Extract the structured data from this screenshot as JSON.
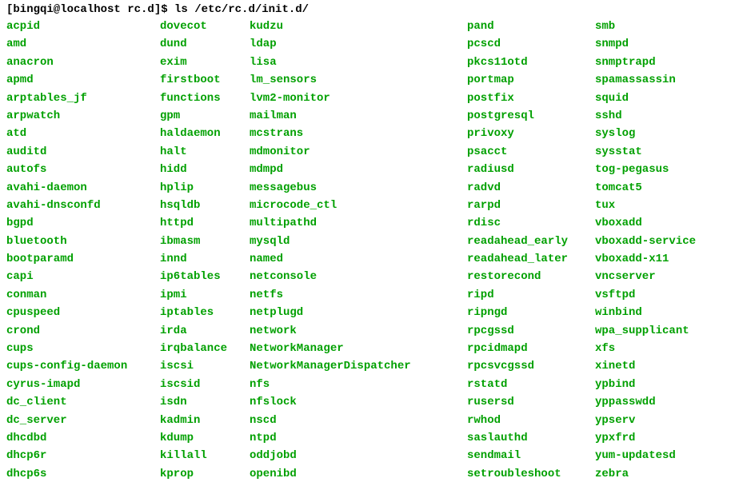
{
  "prompt": "[bingqi@localhost rc.d]$ ls /etc/rc.d/init.d/",
  "columns": [
    [
      "acpid",
      "amd",
      "anacron",
      "apmd",
      "arptables_jf",
      "arpwatch",
      "atd",
      "auditd",
      "autofs",
      "avahi-daemon",
      "avahi-dnsconfd",
      "bgpd",
      "bluetooth",
      "bootparamd",
      "capi",
      "conman",
      "cpuspeed",
      "crond",
      "cups",
      "cups-config-daemon",
      "cyrus-imapd",
      "dc_client",
      "dc_server",
      "dhcdbd",
      "dhcp6r",
      "dhcp6s"
    ],
    [
      "dovecot",
      "dund",
      "exim",
      "firstboot",
      "functions",
      "gpm",
      "haldaemon",
      "halt",
      "hidd",
      "hplip",
      "hsqldb",
      "httpd",
      "ibmasm",
      "innd",
      "ip6tables",
      "ipmi",
      "iptables",
      "irda",
      "irqbalance",
      "iscsi",
      "iscsid",
      "isdn",
      "kadmin",
      "kdump",
      "killall",
      "kprop"
    ],
    [
      "kudzu",
      "ldap",
      "lisa",
      "lm_sensors",
      "lvm2-monitor",
      "mailman",
      "mcstrans",
      "mdmonitor",
      "mdmpd",
      "messagebus",
      "microcode_ctl",
      "multipathd",
      "mysqld",
      "named",
      "netconsole",
      "netfs",
      "netplugd",
      "network",
      "NetworkManager",
      "NetworkManagerDispatcher",
      "nfs",
      "nfslock",
      "nscd",
      "ntpd",
      "oddjobd",
      "openibd"
    ],
    [
      "pand",
      "pcscd",
      "pkcs11otd",
      "portmap",
      "postfix",
      "postgresql",
      "privoxy",
      "psacct",
      "radiusd",
      "radvd",
      "rarpd",
      "rdisc",
      "readahead_early",
      "readahead_later",
      "restorecond",
      "ripd",
      "ripngd",
      "rpcgssd",
      "rpcidmapd",
      "rpcsvcgssd",
      "rstatd",
      "rusersd",
      "rwhod",
      "saslauthd",
      "sendmail",
      "setroubleshoot"
    ],
    [
      "smb",
      "snmpd",
      "snmptrapd",
      "spamassassin",
      "squid",
      "sshd",
      "syslog",
      "sysstat",
      "tog-pegasus",
      "tomcat5",
      "tux",
      "vboxadd",
      "vboxadd-service",
      "vboxadd-x11",
      "vncserver",
      "vsftpd",
      "winbind",
      "wpa_supplicant",
      "xfs",
      "xinetd",
      "ypbind",
      "yppasswdd",
      "ypserv",
      "ypxfrd",
      "yum-updatesd",
      "zebra"
    ]
  ]
}
